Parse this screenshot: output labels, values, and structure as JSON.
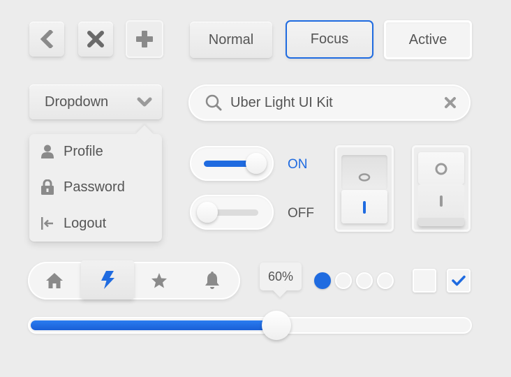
{
  "icon_buttons": [
    {
      "icon": "chevron-left-icon"
    },
    {
      "icon": "close-icon"
    },
    {
      "icon": "plus-icon"
    }
  ],
  "buttons": {
    "normal_label": "Normal",
    "focus_label": "Focus",
    "active_label": "Active"
  },
  "dropdown": {
    "label": "Dropdown",
    "items": [
      {
        "label": "Profile",
        "icon": "user-icon"
      },
      {
        "label": "Password",
        "icon": "lock-icon"
      },
      {
        "label": "Logout",
        "icon": "logout-icon"
      }
    ]
  },
  "search": {
    "value": "Uber Light UI Kit"
  },
  "toggles": {
    "on_label": "ON",
    "off_label": "OFF"
  },
  "tabs": [
    {
      "icon": "home-icon"
    },
    {
      "icon": "lightning-icon",
      "active": true
    },
    {
      "icon": "star-icon"
    },
    {
      "icon": "bell-icon"
    }
  ],
  "progress": {
    "label": "60%",
    "value": 0.56
  },
  "pagination": {
    "count": 4,
    "active_index": 0
  },
  "checkboxes": [
    {
      "checked": false
    },
    {
      "checked": true
    }
  ],
  "colors": {
    "accent": "#1f6be0",
    "icon": "#8a8a8a",
    "text": "#555555"
  }
}
